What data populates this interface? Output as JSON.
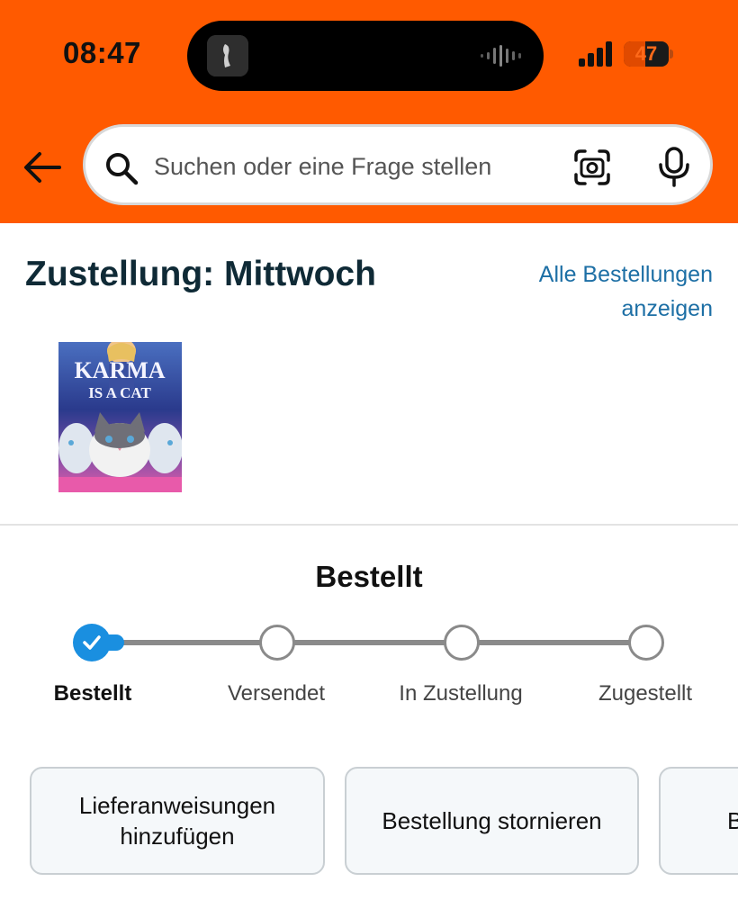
{
  "status_bar": {
    "time": "08:47",
    "battery_level": "47",
    "battery_fraction": 0.47
  },
  "header": {
    "back_icon": "arrow-left-icon",
    "search": {
      "placeholder": "Suchen oder eine Frage stellen",
      "value": "",
      "icons": [
        "search-icon",
        "camera-scan-icon",
        "microphone-icon"
      ]
    }
  },
  "delivery": {
    "title": "Zustellung: Mittwoch",
    "all_orders_link_line1": "Alle Bestellungen",
    "all_orders_link_line2": "anzeigen"
  },
  "product": {
    "cover_title_line1": "KARMA",
    "cover_title_line2": "IS A CAT"
  },
  "tracking": {
    "current_status": "Bestellt",
    "steps": [
      {
        "label": "Bestellt",
        "completed": true
      },
      {
        "label": "Versendet",
        "completed": false
      },
      {
        "label": "In Zustellung",
        "completed": false
      },
      {
        "label": "Zugestellt",
        "completed": false
      }
    ]
  },
  "actions": {
    "add_instructions_line1": "Lieferanweisungen",
    "add_instructions_line2": "hinzufügen",
    "cancel_order": "Bestellung stornieren",
    "third_partial": "B"
  },
  "colors": {
    "header_bg": "#ff5a00",
    "link": "#1d6fa5",
    "progress_active": "#1a8fe0",
    "title_text": "#0f2a36"
  }
}
